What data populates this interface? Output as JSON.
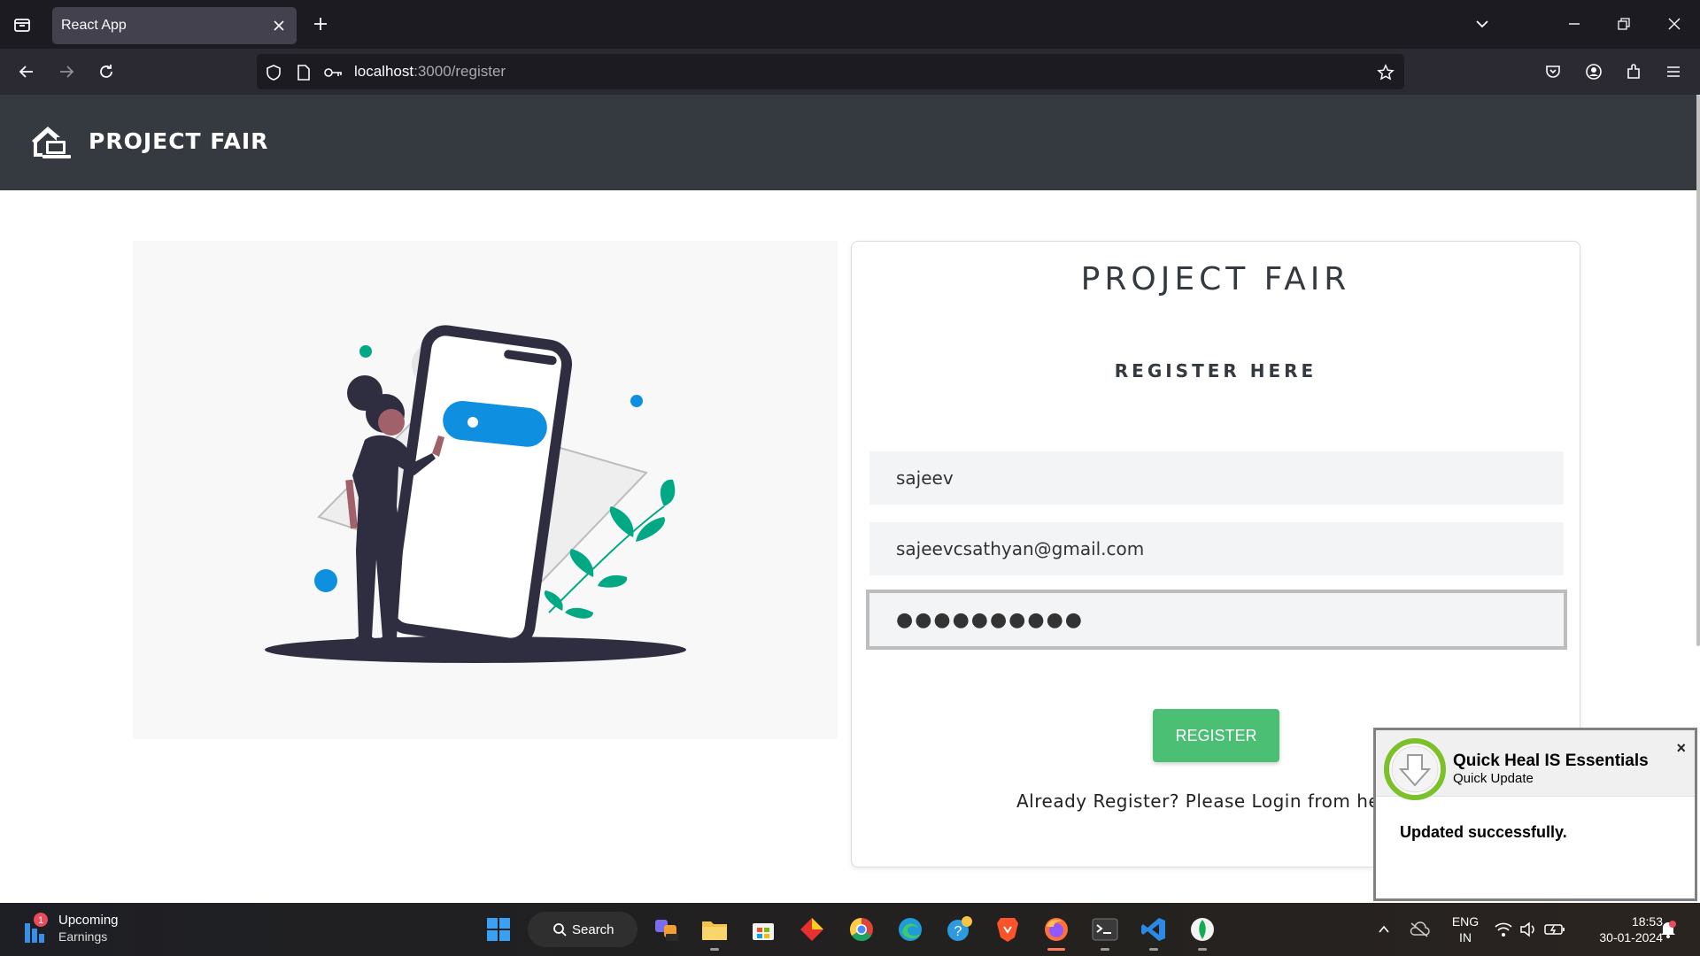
{
  "browser": {
    "tab_title": "React App",
    "url_host": "localhost",
    "url_path": ":3000/register"
  },
  "app": {
    "brand": "PROJECT FAIR",
    "card_title": "PROJECT FAIR",
    "card_subtitle": "REGISTER HERE",
    "fields": {
      "username_value": "sajeev",
      "email_value": "sajeevcsathyan@gmail.com",
      "password_masked": "●●●●●●●●●●"
    },
    "register_label": "REGISTER",
    "login_prompt": "Already Register? Please Login from he"
  },
  "notification": {
    "title": "Quick Heal IS Essentials",
    "subtitle": "Quick Update",
    "message": "Updated successfully.",
    "close": "×"
  },
  "taskbar": {
    "widget_title": "Upcoming",
    "widget_sub": "Earnings",
    "widget_badge": "1",
    "search_label": "Search",
    "lang_line1": "ENG",
    "lang_line2": "IN",
    "time": "18:53",
    "date": "30-01-2024"
  },
  "colors": {
    "header_bg": "#343a40",
    "register_btn": "#4bbf73",
    "accent_teal": "#00a884",
    "accent_blue": "#0f8fe0"
  }
}
